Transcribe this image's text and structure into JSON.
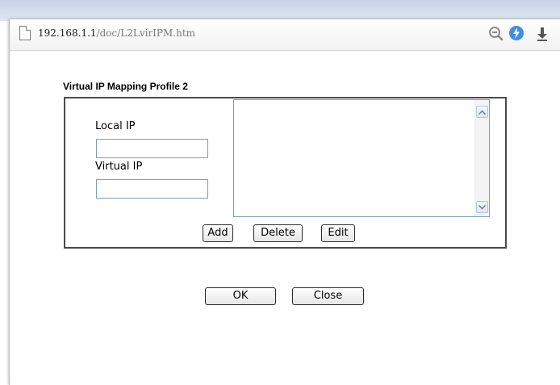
{
  "browser": {
    "url_host": "192.168.1.1",
    "url_path": "/doc/L2LvirIPM.htm",
    "icons": [
      "page-icon",
      "zoom-icon",
      "lightning-icon",
      "download-icon"
    ]
  },
  "dialog": {
    "title": "Virtual IP Mapping Profile 2",
    "local_ip_label": "Local IP",
    "local_ip_value": "",
    "virtual_ip_label": "Virtual IP",
    "virtual_ip_value": "",
    "list_items": [],
    "add_label": "Add",
    "delete_label": "Delete",
    "edit_label": "Edit",
    "ok_label": "OK",
    "close_label": "Close"
  },
  "colors": {
    "input_border": "#7f9db9",
    "panel_border": "#4a4a4a",
    "accent_blue": "#3f8fe0"
  }
}
